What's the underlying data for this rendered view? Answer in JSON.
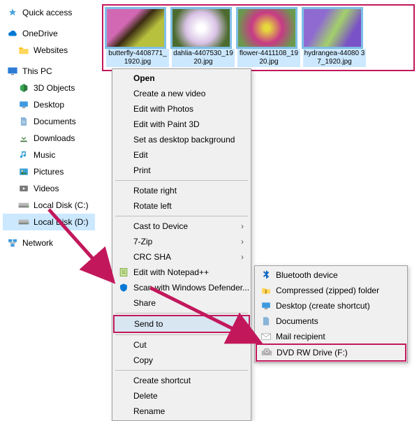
{
  "sidebar": {
    "quick_access": "Quick access",
    "onedrive": "OneDrive",
    "websites": "Websites",
    "this_pc": "This PC",
    "objects3d": "3D Objects",
    "desktop": "Desktop",
    "documents": "Documents",
    "downloads": "Downloads",
    "music": "Music",
    "pictures": "Pictures",
    "videos": "Videos",
    "local_c": "Local Disk (C:)",
    "local_d": "Local Disk (D:)",
    "network": "Network"
  },
  "thumbs": {
    "t1": "butterfly-4408771_1920.jpg",
    "t2": "dahlia-4407530_1920.jpg",
    "t3": "flower-4411108_1920.jpg",
    "t4": "hydrangea-44080 37_1920.jpg"
  },
  "menu": {
    "open": "Open",
    "create_video": "Create a new video",
    "edit_photos": "Edit with Photos",
    "edit_paint3d": "Edit with Paint 3D",
    "set_bg": "Set as desktop background",
    "edit": "Edit",
    "print": "Print",
    "rot_right": "Rotate right",
    "rot_left": "Rotate left",
    "cast": "Cast to Device",
    "sevenzip": "7-Zip",
    "crc": "CRC SHA",
    "notepadpp": "Edit with Notepad++",
    "defender": "Scan with Windows Defender...",
    "share": "Share",
    "send_to": "Send to",
    "cut": "Cut",
    "copy": "Copy",
    "create_shortcut": "Create shortcut",
    "delete": "Delete",
    "rename": "Rename"
  },
  "submenu": {
    "bluetooth": "Bluetooth device",
    "zipped": "Compressed (zipped) folder",
    "desktop_sc": "Desktop (create shortcut)",
    "documents": "Documents",
    "mail": "Mail recipient",
    "dvd": "DVD RW Drive (F:)"
  },
  "icons": {
    "quick_star": "★",
    "chevron": "›"
  },
  "colors": {
    "highlight_border": "#c2185b",
    "arrow_color": "#c2185b"
  }
}
